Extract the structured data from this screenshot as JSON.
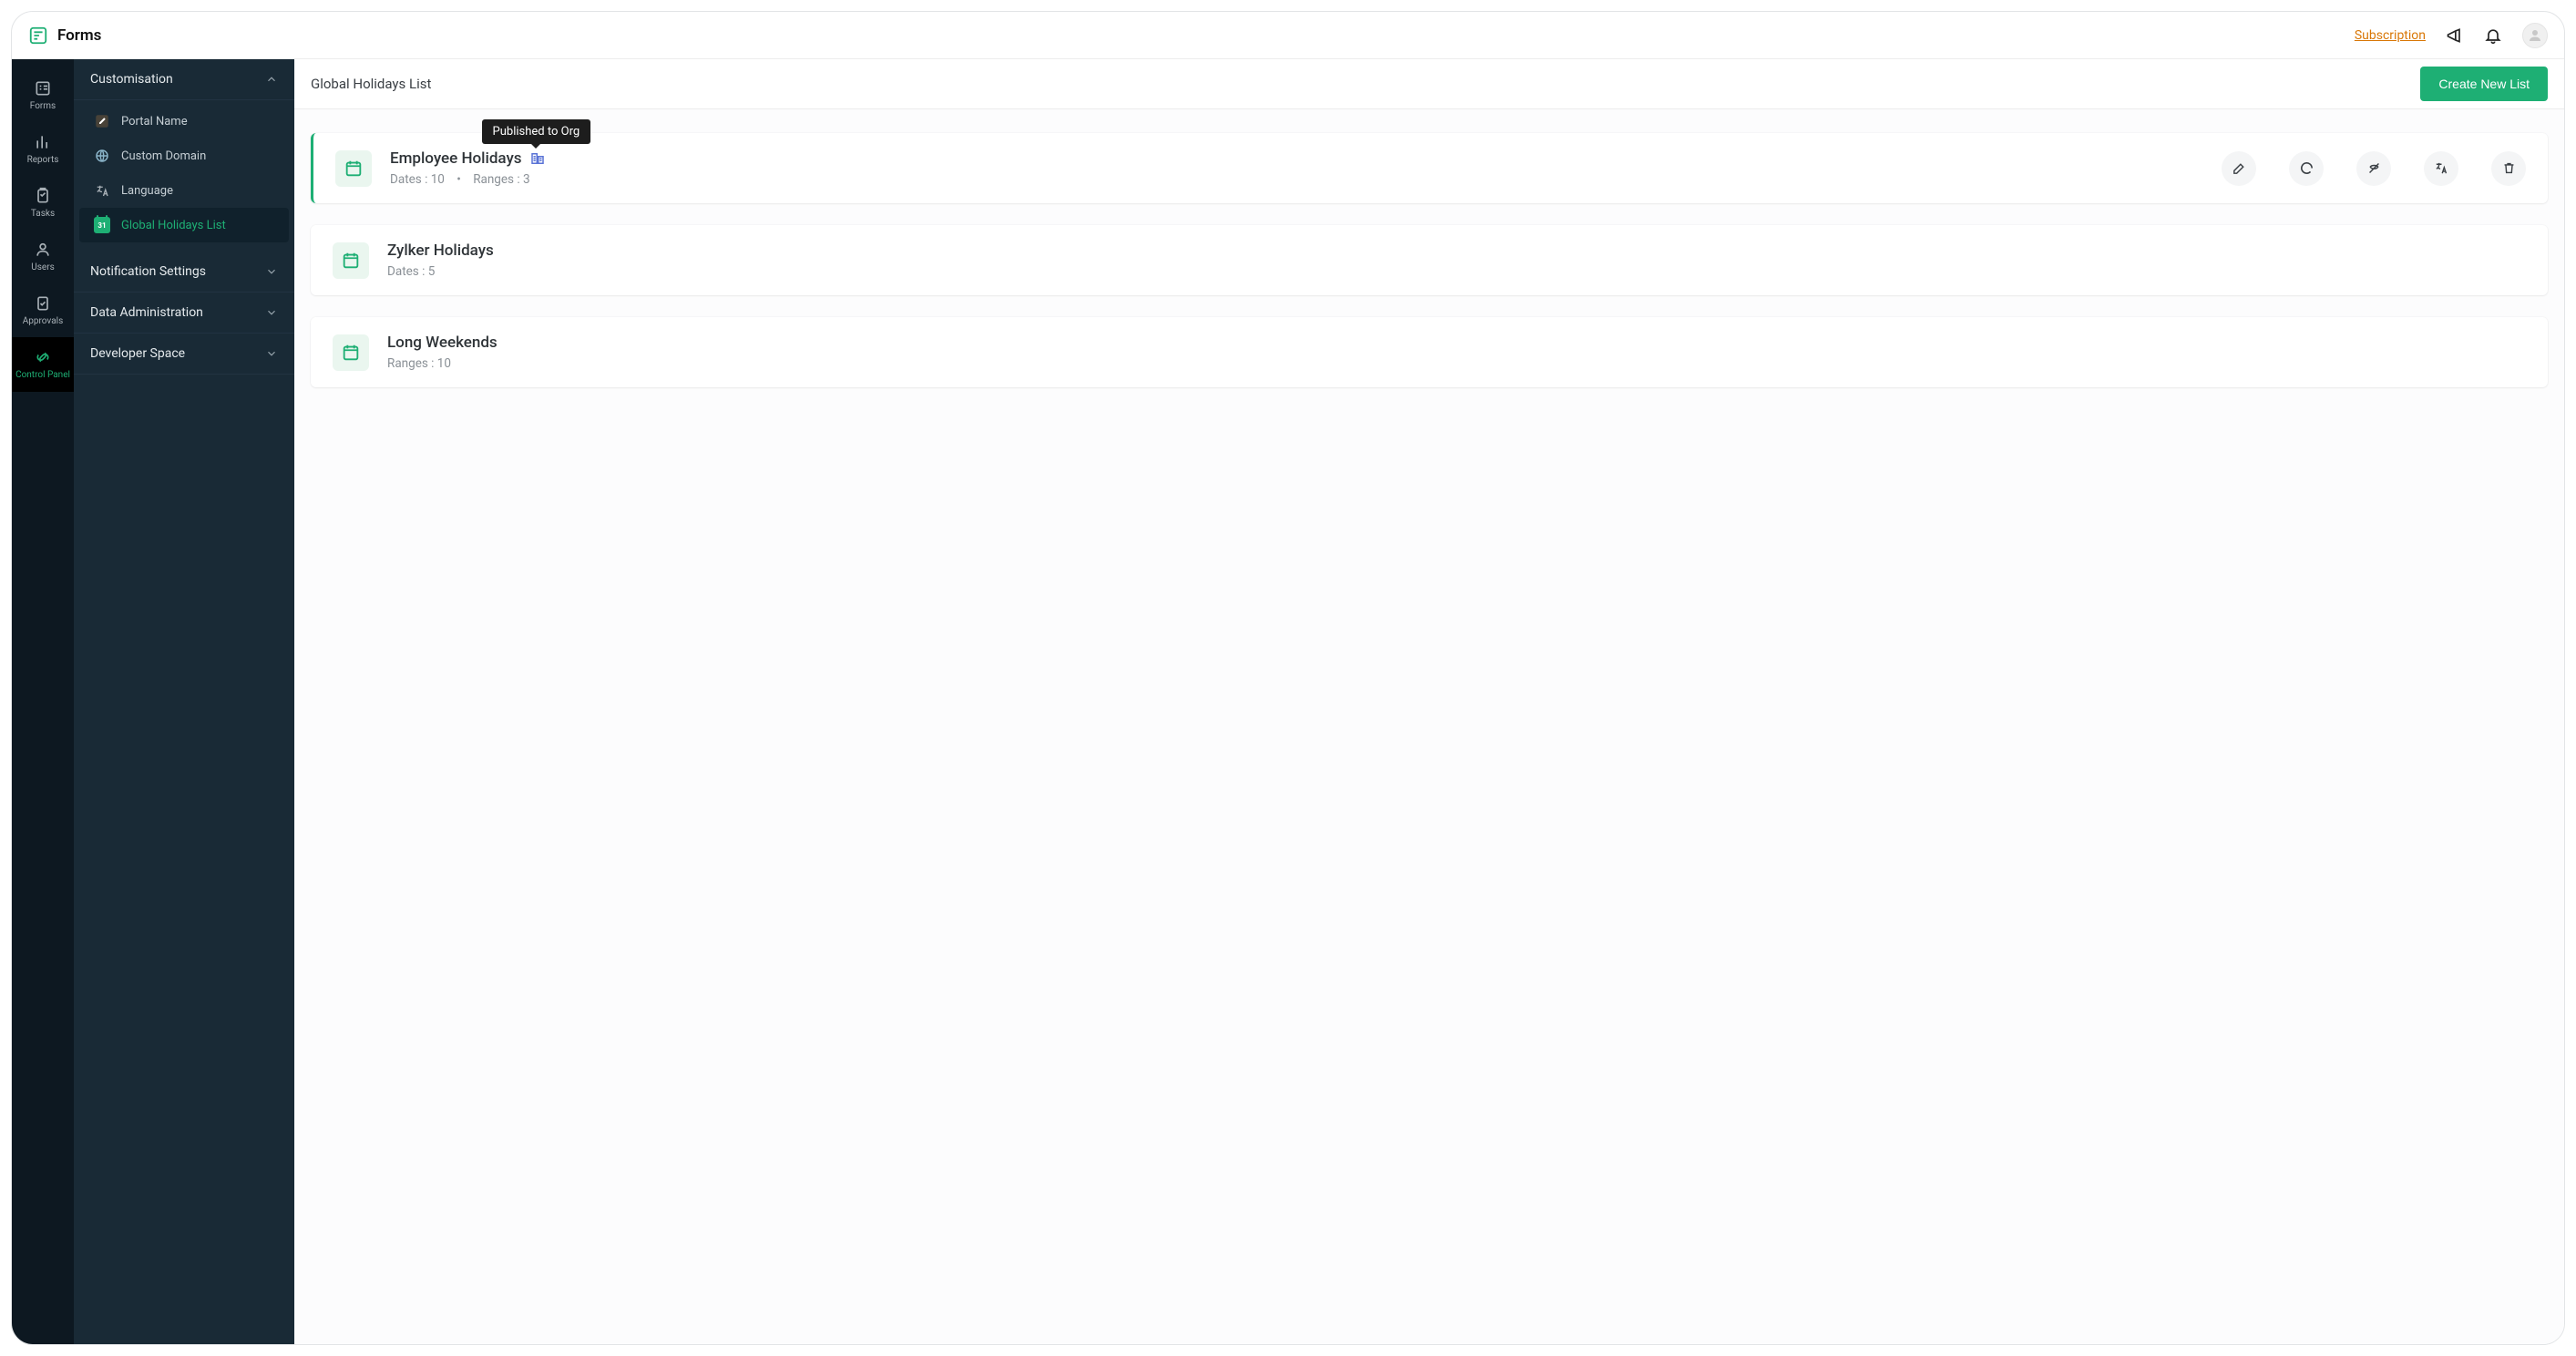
{
  "header": {
    "app_name": "Forms",
    "subscription_label": "Subscription"
  },
  "rail": [
    {
      "id": "forms",
      "label": "Forms"
    },
    {
      "id": "reports",
      "label": "Reports"
    },
    {
      "id": "tasks",
      "label": "Tasks"
    },
    {
      "id": "users",
      "label": "Users"
    },
    {
      "id": "approvals",
      "label": "Approvals"
    },
    {
      "id": "control-panel",
      "label": "Control Panel"
    }
  ],
  "side": {
    "groups": [
      {
        "label": "Customisation",
        "expanded": true,
        "items": [
          {
            "id": "portal-name",
            "label": "Portal Name"
          },
          {
            "id": "custom-domain",
            "label": "Custom Domain"
          },
          {
            "id": "language",
            "label": "Language"
          },
          {
            "id": "global-holidays",
            "label": "Global Holidays List",
            "active": true,
            "icon_text": "31"
          }
        ]
      },
      {
        "label": "Notification Settings",
        "expanded": false
      },
      {
        "label": "Data Administration",
        "expanded": false
      },
      {
        "label": "Developer Space",
        "expanded": false
      }
    ]
  },
  "page": {
    "title": "Global Holidays List",
    "create_button": "Create New List",
    "tooltip_published": "Published to Org",
    "meta_labels": {
      "dates": "Dates",
      "ranges": "Ranges"
    },
    "lists": [
      {
        "name": "Employee Holidays",
        "dates": 10,
        "ranges": 3,
        "published_to_org": true,
        "selected": true
      },
      {
        "name": "Zylker Holidays",
        "dates": 5
      },
      {
        "name": "Long Weekends",
        "ranges": 10
      }
    ]
  }
}
